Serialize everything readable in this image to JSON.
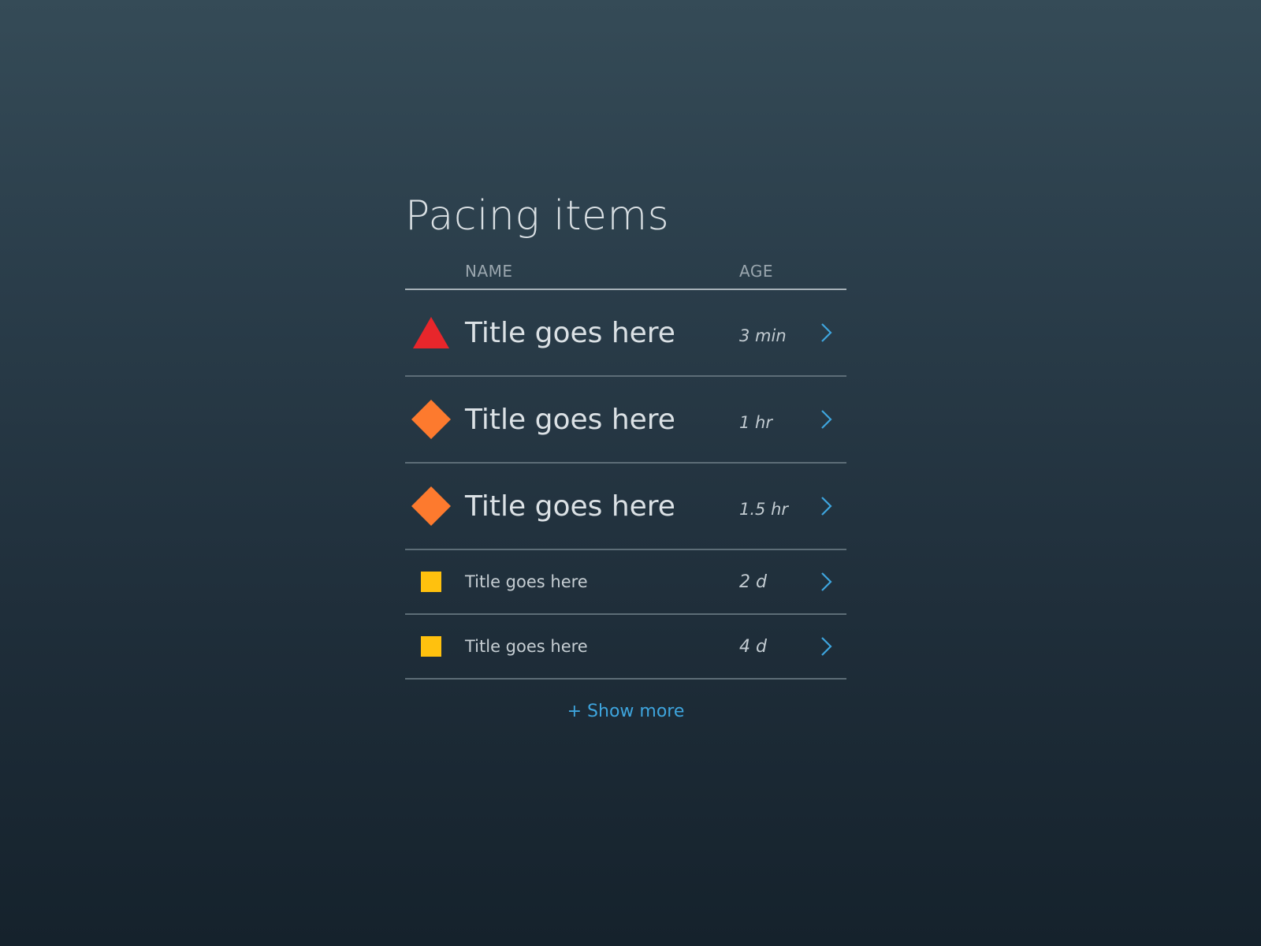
{
  "panel": {
    "title": "Pacing items",
    "columns": {
      "name": "NAME",
      "age": "AGE"
    },
    "rows": [
      {
        "name": "Title goes here",
        "age": "3 min",
        "severity": "critical",
        "icon": "triangle-icon",
        "color": "#e8262b"
      },
      {
        "name": "Title goes here",
        "age": "1 hr",
        "severity": "major",
        "icon": "diamond-icon",
        "color": "#fd7a2e"
      },
      {
        "name": "Title goes here",
        "age": "1.5 hr",
        "severity": "major",
        "icon": "diamond-icon",
        "color": "#fd7a2e"
      },
      {
        "name": "Title goes here",
        "age": "2 d",
        "severity": "minor",
        "icon": "square-icon",
        "color": "#ffc10e"
      },
      {
        "name": "Title goes here",
        "age": "4 d",
        "severity": "minor",
        "icon": "square-icon",
        "color": "#ffc10e"
      }
    ],
    "show_more_label": "+ Show more"
  },
  "colors": {
    "accent": "#3ea5de",
    "critical": "#e8262b",
    "major": "#fd7a2e",
    "minor": "#ffc10e"
  }
}
